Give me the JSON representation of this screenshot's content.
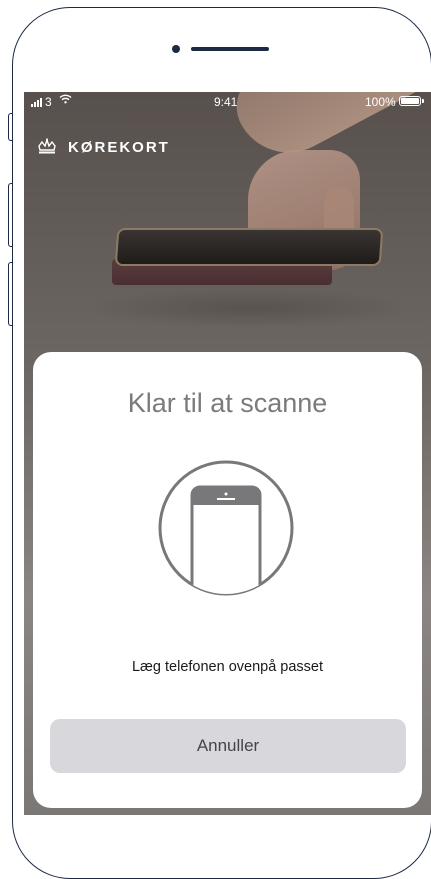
{
  "status_bar": {
    "carrier": "3",
    "time": "9:41",
    "battery": "100%"
  },
  "header": {
    "app_name": "KØREKORT",
    "logo_icon": "crown-icon"
  },
  "scan_sheet": {
    "title": "Klar til at scanne",
    "icon": "phone-scan-icon",
    "instruction": "Læg telefonen ovenpå passet",
    "cancel_label": "Annuller"
  },
  "colors": {
    "frame": "#1c2a44",
    "sheet_title": "#7b7b7e",
    "cancel_button_bg": "#d8d8dc",
    "cancel_button_text": "#454549"
  }
}
